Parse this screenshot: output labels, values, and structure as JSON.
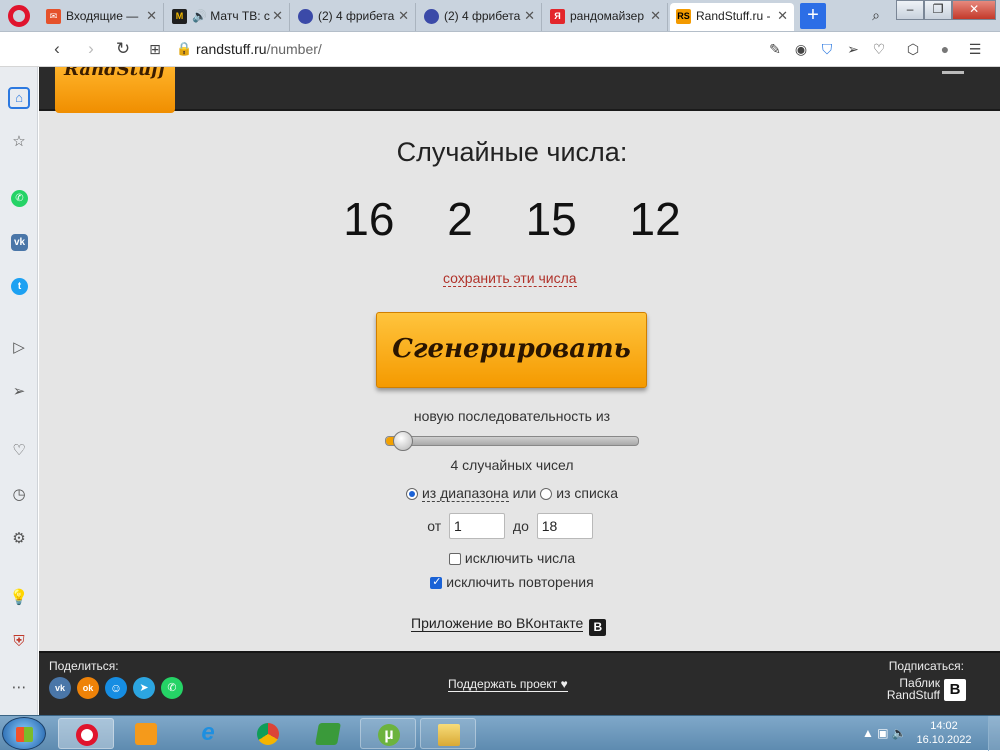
{
  "browser": {
    "tabs": [
      {
        "title": "Входящие —",
        "icon": "mail-icon",
        "color": "#e5512a",
        "glyph": ""
      },
      {
        "title": "Матч ТВ: с",
        "icon": "matchtv-icon",
        "color": "#1f1f1f",
        "glyph": "M"
      },
      {
        "title": "(2) 4 фрибета",
        "icon": "site-icon",
        "color": "#3b4aa8",
        "glyph": ""
      },
      {
        "title": "(2) 4 фрибета",
        "icon": "site-icon",
        "color": "#3b4aa8",
        "glyph": ""
      },
      {
        "title": "рандомайзер",
        "icon": "yandex-icon",
        "color": "#e3262b",
        "glyph": "Я"
      },
      {
        "title": "RandStuff.ru -",
        "icon": "randstuff-icon",
        "color": "#f39a00",
        "glyph": "RS"
      }
    ],
    "url_host": "randstuff.ru",
    "url_path": "/number/"
  },
  "page": {
    "logo_text": "RandStuff",
    "title": "Случайные числа:",
    "numbers": [
      "16",
      "2",
      "15",
      "12"
    ],
    "save_link": "сохранить эти числа",
    "generate_button": "Сгенерировать",
    "sequence_label": "новую последовательность из",
    "slider_value": 4,
    "slider_min": 1,
    "slider_max": 99,
    "count_label": "4 случайных чисел",
    "mode_range": "из диапазона",
    "mode_or": "или",
    "mode_list": "из списка",
    "mode_selected": "range",
    "from_label": "от",
    "from_value": "1",
    "to_label": "до",
    "to_value": "18",
    "exclude_numbers_label": "исключить числа",
    "exclude_numbers_checked": false,
    "exclude_repeats_label": "исключить повторения",
    "exclude_repeats_checked": true,
    "vk_app_link": "Приложение во ВКонтакте"
  },
  "footer": {
    "share_label": "Поделиться:",
    "share_icons": [
      {
        "name": "vk-share-icon",
        "color": "#4a76a8",
        "glyph": "vk"
      },
      {
        "name": "ok-share-icon",
        "color": "#ee8208",
        "glyph": "ok"
      },
      {
        "name": "mailru-share-icon",
        "color": "#168de2",
        "glyph": "☺"
      },
      {
        "name": "telegram-share-icon",
        "color": "#2ca5e0",
        "glyph": "➤"
      },
      {
        "name": "whatsapp-share-icon",
        "color": "#25d366",
        "glyph": "✆"
      }
    ],
    "support_link": "Поддержать проект",
    "subscribe_label": "Подписаться:",
    "public_line1": "Паблик",
    "public_line2": "RandStuff"
  },
  "taskbar": {
    "time": "14:02",
    "date": "16.10.2022"
  },
  "colors": {
    "accent_orange": "#f59a00",
    "header_dark": "#2b2b2b",
    "link_red": "#b0322a"
  }
}
